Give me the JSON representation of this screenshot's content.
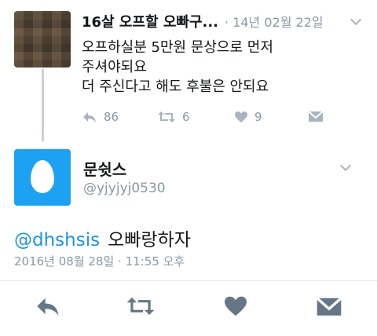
{
  "reply_tweet": {
    "name": "16살 오프할 오빠구...",
    "date": "· 14년 02월 22일",
    "text_lines": [
      "오프하실분 5만원 문상으로 먼저",
      "주셔야되요",
      "더 주신다고 해도 후불은 안되요"
    ],
    "actions": {
      "reply_count": "86",
      "retweet_count": "6",
      "like_count": "9"
    }
  },
  "main_tweet": {
    "name": "문쉿스",
    "handle": "@yjyjyj0530",
    "mention": "@dhshsis",
    "text": "오빠랑하자",
    "timestamp": "2016년 08월 28일 · 11:55 오후"
  },
  "colors": {
    "accent": "#1da1f2",
    "mention": "#1b95e0",
    "muted": "#8899a6",
    "action_icon": "#657786"
  }
}
